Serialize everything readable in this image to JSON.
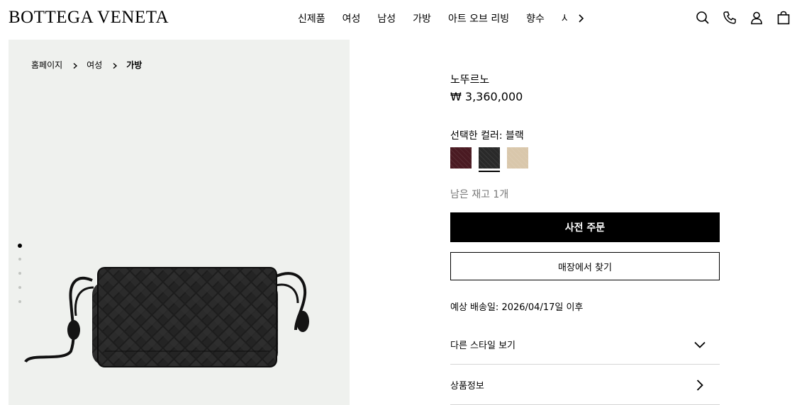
{
  "brand": {
    "logo_text": "BOTTEGA VENETA"
  },
  "nav": {
    "items": [
      "신제품",
      "여성",
      "남성",
      "가방",
      "아트 오브 리빙",
      "향수"
    ],
    "partial_item": "사",
    "next_icon": "chevron-right-icon"
  },
  "header_icons": [
    "search-icon",
    "phone-icon",
    "account-icon",
    "shopping-bag-icon"
  ],
  "breadcrumb": {
    "items": [
      "홈페이지",
      "여성",
      "가방"
    ],
    "separator_icon": "chevron-right-icon"
  },
  "gallery": {
    "dot_count": 5,
    "active_index": 0
  },
  "product": {
    "name": "노뚜르노",
    "price": "₩ 3,360,000",
    "selected_color_label": "선택한 컬러: 블랙",
    "colors": [
      {
        "name": "burgundy",
        "hex": "#4a1a22",
        "selected": false
      },
      {
        "name": "black",
        "hex": "#2a2a2a",
        "selected": true
      },
      {
        "name": "beige",
        "hex": "#d9c7ab",
        "selected": false
      }
    ],
    "stock_text": "남은 재고 1개",
    "preorder_button": "사전 주문",
    "find_in_store_button": "매장에서 찾기",
    "delivery_text": "예상 배송일: 2026/04/17일 이후",
    "accordions": [
      {
        "label": "다른 스타일 보기",
        "icon": "chevron-down-icon"
      },
      {
        "label": "상품정보",
        "icon": "chevron-right-icon"
      }
    ]
  },
  "colors": {
    "background": "#ffffff",
    "image_bg": "#eff1ee",
    "primary_button": "#000000",
    "muted_text": "#777777"
  }
}
